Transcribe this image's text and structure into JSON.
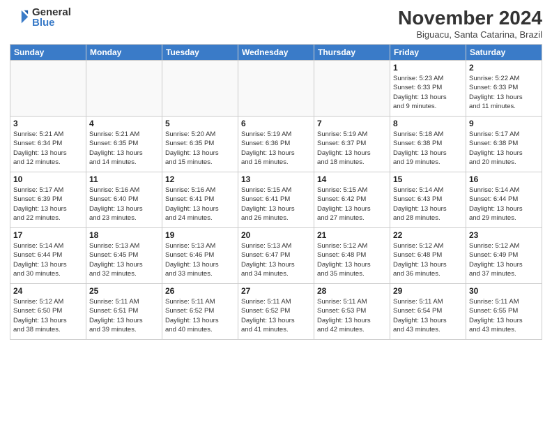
{
  "logo": {
    "general": "General",
    "blue": "Blue"
  },
  "title": "November 2024",
  "subtitle": "Biguacu, Santa Catarina, Brazil",
  "weekdays": [
    "Sunday",
    "Monday",
    "Tuesday",
    "Wednesday",
    "Thursday",
    "Friday",
    "Saturday"
  ],
  "weeks": [
    [
      {
        "day": "",
        "info": ""
      },
      {
        "day": "",
        "info": ""
      },
      {
        "day": "",
        "info": ""
      },
      {
        "day": "",
        "info": ""
      },
      {
        "day": "",
        "info": ""
      },
      {
        "day": "1",
        "info": "Sunrise: 5:23 AM\nSunset: 6:33 PM\nDaylight: 13 hours\nand 9 minutes."
      },
      {
        "day": "2",
        "info": "Sunrise: 5:22 AM\nSunset: 6:33 PM\nDaylight: 13 hours\nand 11 minutes."
      }
    ],
    [
      {
        "day": "3",
        "info": "Sunrise: 5:21 AM\nSunset: 6:34 PM\nDaylight: 13 hours\nand 12 minutes."
      },
      {
        "day": "4",
        "info": "Sunrise: 5:21 AM\nSunset: 6:35 PM\nDaylight: 13 hours\nand 14 minutes."
      },
      {
        "day": "5",
        "info": "Sunrise: 5:20 AM\nSunset: 6:35 PM\nDaylight: 13 hours\nand 15 minutes."
      },
      {
        "day": "6",
        "info": "Sunrise: 5:19 AM\nSunset: 6:36 PM\nDaylight: 13 hours\nand 16 minutes."
      },
      {
        "day": "7",
        "info": "Sunrise: 5:19 AM\nSunset: 6:37 PM\nDaylight: 13 hours\nand 18 minutes."
      },
      {
        "day": "8",
        "info": "Sunrise: 5:18 AM\nSunset: 6:38 PM\nDaylight: 13 hours\nand 19 minutes."
      },
      {
        "day": "9",
        "info": "Sunrise: 5:17 AM\nSunset: 6:38 PM\nDaylight: 13 hours\nand 20 minutes."
      }
    ],
    [
      {
        "day": "10",
        "info": "Sunrise: 5:17 AM\nSunset: 6:39 PM\nDaylight: 13 hours\nand 22 minutes."
      },
      {
        "day": "11",
        "info": "Sunrise: 5:16 AM\nSunset: 6:40 PM\nDaylight: 13 hours\nand 23 minutes."
      },
      {
        "day": "12",
        "info": "Sunrise: 5:16 AM\nSunset: 6:41 PM\nDaylight: 13 hours\nand 24 minutes."
      },
      {
        "day": "13",
        "info": "Sunrise: 5:15 AM\nSunset: 6:41 PM\nDaylight: 13 hours\nand 26 minutes."
      },
      {
        "day": "14",
        "info": "Sunrise: 5:15 AM\nSunset: 6:42 PM\nDaylight: 13 hours\nand 27 minutes."
      },
      {
        "day": "15",
        "info": "Sunrise: 5:14 AM\nSunset: 6:43 PM\nDaylight: 13 hours\nand 28 minutes."
      },
      {
        "day": "16",
        "info": "Sunrise: 5:14 AM\nSunset: 6:44 PM\nDaylight: 13 hours\nand 29 minutes."
      }
    ],
    [
      {
        "day": "17",
        "info": "Sunrise: 5:14 AM\nSunset: 6:44 PM\nDaylight: 13 hours\nand 30 minutes."
      },
      {
        "day": "18",
        "info": "Sunrise: 5:13 AM\nSunset: 6:45 PM\nDaylight: 13 hours\nand 32 minutes."
      },
      {
        "day": "19",
        "info": "Sunrise: 5:13 AM\nSunset: 6:46 PM\nDaylight: 13 hours\nand 33 minutes."
      },
      {
        "day": "20",
        "info": "Sunrise: 5:13 AM\nSunset: 6:47 PM\nDaylight: 13 hours\nand 34 minutes."
      },
      {
        "day": "21",
        "info": "Sunrise: 5:12 AM\nSunset: 6:48 PM\nDaylight: 13 hours\nand 35 minutes."
      },
      {
        "day": "22",
        "info": "Sunrise: 5:12 AM\nSunset: 6:48 PM\nDaylight: 13 hours\nand 36 minutes."
      },
      {
        "day": "23",
        "info": "Sunrise: 5:12 AM\nSunset: 6:49 PM\nDaylight: 13 hours\nand 37 minutes."
      }
    ],
    [
      {
        "day": "24",
        "info": "Sunrise: 5:12 AM\nSunset: 6:50 PM\nDaylight: 13 hours\nand 38 minutes."
      },
      {
        "day": "25",
        "info": "Sunrise: 5:11 AM\nSunset: 6:51 PM\nDaylight: 13 hours\nand 39 minutes."
      },
      {
        "day": "26",
        "info": "Sunrise: 5:11 AM\nSunset: 6:52 PM\nDaylight: 13 hours\nand 40 minutes."
      },
      {
        "day": "27",
        "info": "Sunrise: 5:11 AM\nSunset: 6:52 PM\nDaylight: 13 hours\nand 41 minutes."
      },
      {
        "day": "28",
        "info": "Sunrise: 5:11 AM\nSunset: 6:53 PM\nDaylight: 13 hours\nand 42 minutes."
      },
      {
        "day": "29",
        "info": "Sunrise: 5:11 AM\nSunset: 6:54 PM\nDaylight: 13 hours\nand 43 minutes."
      },
      {
        "day": "30",
        "info": "Sunrise: 5:11 AM\nSunset: 6:55 PM\nDaylight: 13 hours\nand 43 minutes."
      }
    ]
  ]
}
